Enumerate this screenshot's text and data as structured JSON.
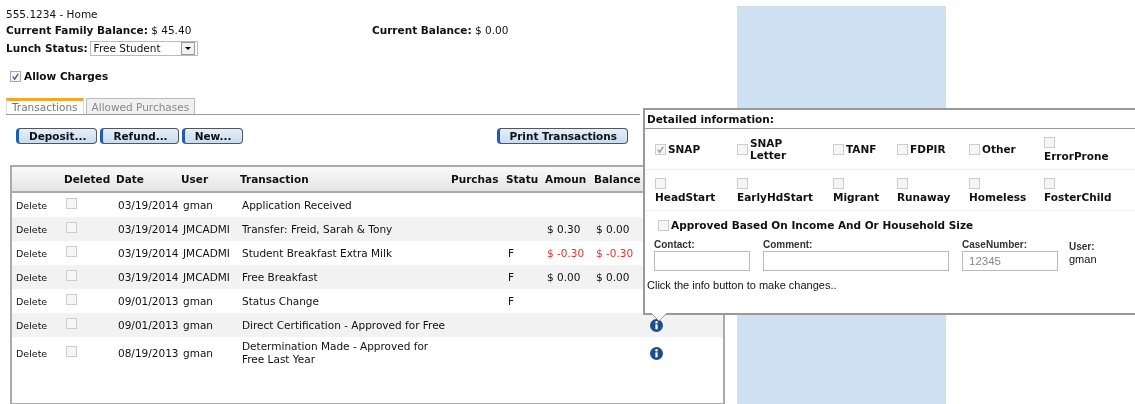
{
  "header": {
    "phone": "555.1234 - Home",
    "family_balance_label": "Current Family Balance:",
    "family_balance": "$ 45.40",
    "balance_label": "Current Balance:",
    "balance": "$ 0.00",
    "lunch_status_label": "Lunch Status:",
    "lunch_status": "Free Student",
    "allow_charges": {
      "label": "Allow Charges",
      "checked": true
    }
  },
  "tabs": [
    {
      "label": "Transactions",
      "selected": true
    },
    {
      "label": "Allowed Purchases",
      "selected": false
    }
  ],
  "buttons": [
    "Deposit...",
    "Refund...",
    "New..."
  ],
  "print_button": "Print Transactions",
  "table": {
    "columns": [
      "",
      "Deleted",
      "Date",
      "User",
      "Transaction",
      "Purchas",
      "Statu",
      "Amoun",
      "Balance"
    ],
    "rows": [
      {
        "action": "Delete",
        "deleted": false,
        "date": "03/19/2014",
        "user": "gman",
        "transaction": "Application Received"
      },
      {
        "action": "Delete",
        "deleted": false,
        "date": "03/19/2014",
        "user": "JMCADMI",
        "transaction": "Transfer: Freid, Sarah & Tony",
        "amount": "$ 0.30",
        "balance": "$ 0.00",
        "negative": false
      },
      {
        "action": "Delete",
        "deleted": false,
        "date": "03/19/2014",
        "user": "JMCADMI",
        "transaction": "Student Breakfast Extra Milk",
        "status": "F",
        "amount": "$ -0.30",
        "balance": "$ -0.30",
        "negative": true
      },
      {
        "action": "Delete",
        "deleted": false,
        "date": "03/19/2014",
        "user": "JMCADMI",
        "transaction": "Free Breakfast",
        "status": "F",
        "amount": "$ 0.00",
        "balance": "$ 0.00",
        "negative": false
      },
      {
        "action": "Delete",
        "deleted": false,
        "date": "09/01/2013",
        "user": "gman",
        "transaction": "Status Change",
        "status": "F"
      },
      {
        "action": "Delete",
        "deleted": false,
        "date": "09/01/2013",
        "user": "gman",
        "transaction": "Direct Certification - Approved for Free",
        "info": true
      },
      {
        "action": "Delete",
        "deleted": false,
        "date": "08/19/2013",
        "user": "gman",
        "transaction": "Determination Made - Approved for Free Last Year",
        "info": true
      }
    ]
  },
  "popup": {
    "title": "Detailed information:",
    "checkbox_rows": [
      [
        {
          "label": "SNAP",
          "checked": true,
          "kind": "inline"
        },
        {
          "label": "SNAP Letter",
          "checked": false,
          "kind": "inline"
        },
        {
          "label": "TANF",
          "checked": false,
          "kind": "inline"
        },
        {
          "label": "FDPIR",
          "checked": false,
          "kind": "inline"
        },
        {
          "label": "Other",
          "checked": false,
          "kind": "inline"
        },
        {
          "label": "ErrorProne",
          "checked": false,
          "kind": "stacked"
        }
      ],
      [
        {
          "label": "HeadStart",
          "checked": false,
          "kind": "stacked"
        },
        {
          "label": "EarlyHdStart",
          "checked": false,
          "kind": "stacked"
        },
        {
          "label": "Migrant",
          "checked": false,
          "kind": "stacked"
        },
        {
          "label": "Runaway",
          "checked": false,
          "kind": "stacked"
        },
        {
          "label": "Homeless",
          "checked": false,
          "kind": "stacked"
        },
        {
          "label": "FosterChild",
          "checked": false,
          "kind": "stacked"
        }
      ]
    ],
    "approved": {
      "label": "Approved Based On Income And Or Household Size",
      "checked": false
    },
    "contact_label": "Contact:",
    "comment_label": "Comment:",
    "case_label": "CaseNumber:",
    "case_number": "12345",
    "user_label": "User:",
    "user": "gman",
    "note": "Click the info button to make changes.."
  }
}
